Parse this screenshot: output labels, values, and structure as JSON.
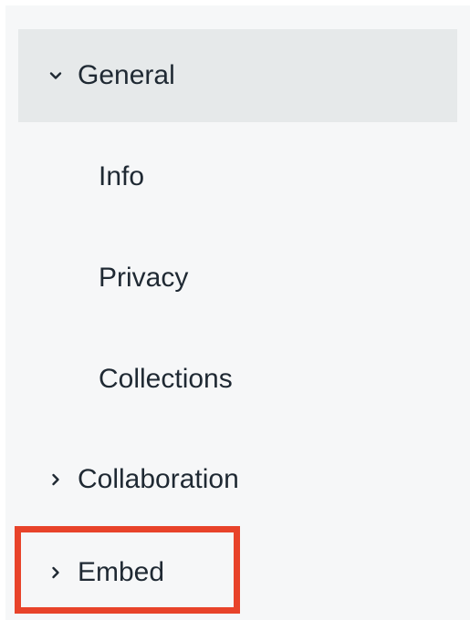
{
  "nav": {
    "general": {
      "label": "General",
      "icon": "chevron-down-icon",
      "expanded": true,
      "selected": true,
      "children": [
        {
          "label": "Info"
        },
        {
          "label": "Privacy"
        },
        {
          "label": "Collections"
        }
      ]
    },
    "collaboration": {
      "label": "Collaboration",
      "icon": "chevron-right-icon",
      "expanded": false
    },
    "embed": {
      "label": "Embed",
      "icon": "chevron-right-icon",
      "expanded": false
    }
  },
  "colors": {
    "panel_background": "#f6f7f8",
    "selected_background": "#e6e9ea",
    "text": "#1f2933",
    "annotation_highlight": "#e8432a"
  }
}
